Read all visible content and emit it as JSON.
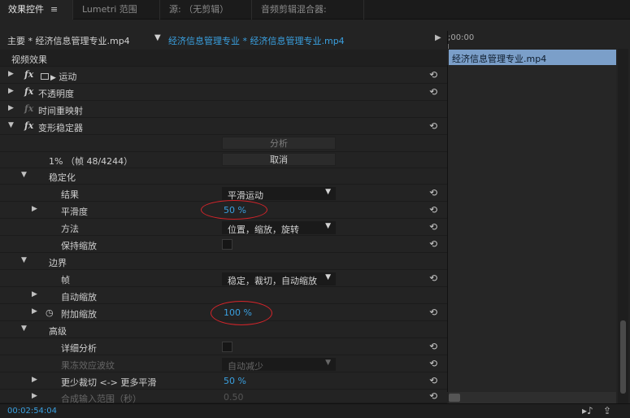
{
  "tabs": [
    {
      "label": "效果控件",
      "menu": "≡"
    },
    {
      "label": "Lumetri 范围"
    },
    {
      "label": "源: （无剪辑）"
    },
    {
      "label": "音频剪辑混合器:"
    }
  ],
  "header": {
    "master": "主要 * 经济信息管理专业.mp4",
    "sequence": "经济信息管理专业 * 经济信息管理专业.mp4"
  },
  "timeline": {
    "timecode": ";00:00",
    "clip": "经济信息管理专业.mp4"
  },
  "effects": {
    "section": "视频效果",
    "motion": "运动",
    "opacity": "不透明度",
    "time_remap": "时间重映射",
    "warp": "变形稳定器",
    "analyze": "分析",
    "progress": "1% （帧 48/4244）",
    "cancel": "取消",
    "stabilization": "稳定化",
    "result": "结果",
    "result_value": "平滑运动",
    "smoothness": "平滑度",
    "smoothness_value": "50 %",
    "method": "方法",
    "method_value": "位置，缩放，旋转",
    "preserve_scale": "保持缩放",
    "borders": "边界",
    "framing": "帧",
    "framing_value": "稳定，裁切，自动缩放",
    "auto_scale": "自动缩放",
    "additional_scale": "附加缩放",
    "additional_scale_value": "100 %",
    "advanced": "高级",
    "detailed_analysis": "详细分析",
    "rolling_shutter": "果冻效应波纹",
    "rolling_shutter_value": "自动减少",
    "crop_smooth": "更少裁切 <-> 更多平滑",
    "crop_smooth_value": "50 %",
    "synth_input": "合成输入范围（秒）",
    "synth_input_value": "0.50"
  },
  "status": {
    "timecode": "00:02:54:04"
  },
  "icons": {
    "reset": "reset-icon",
    "play": "play-icon",
    "stopwatch": "stopwatch-icon"
  },
  "colors": {
    "accent": "#3aa0e0",
    "clip": "#7b9fc9",
    "annotation": "#d3242a"
  }
}
